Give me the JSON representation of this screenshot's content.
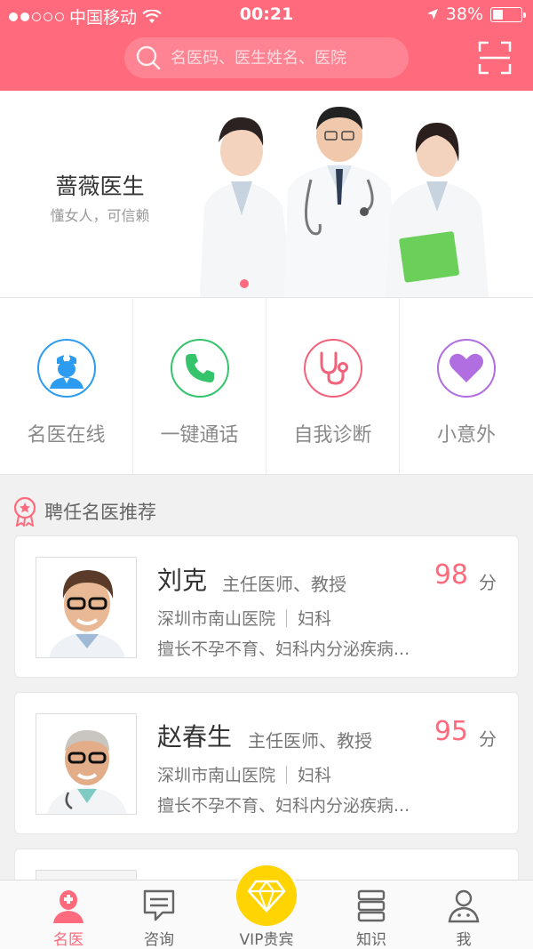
{
  "status_bar": {
    "carrier": "中国移动",
    "time": "00:21",
    "battery_text": "38%",
    "battery_level": 0.38
  },
  "search": {
    "placeholder": "名医码、医生姓名、医院"
  },
  "banner": {
    "title": "蔷薇医生",
    "subtitle": "懂女人，可信赖"
  },
  "quick_actions": [
    {
      "label": "名医在线",
      "icon": "doctor-icon",
      "color": "#2d9cf0"
    },
    {
      "label": "一键通话",
      "icon": "phone-icon",
      "color": "#35c46c"
    },
    {
      "label": "自我诊断",
      "icon": "stethoscope-icon",
      "color": "#f2627a"
    },
    {
      "label": "小意外",
      "icon": "heart-icon",
      "color": "#b06ee0"
    }
  ],
  "section": {
    "title": "聘任名医推荐"
  },
  "doctors": [
    {
      "name": "刘克",
      "title": "主任医师、教授",
      "score": "98",
      "score_unit": "分",
      "hospital": "深圳市南山医院",
      "department": "妇科",
      "description": "擅长不孕不育、妇科内分泌疾病..."
    },
    {
      "name": "赵春生",
      "title": "主任医师、教授",
      "score": "95",
      "score_unit": "分",
      "hospital": "深圳市南山医院",
      "department": "妇科",
      "description": "擅长不孕不育、妇科内分泌疾病..."
    }
  ],
  "tabbar": {
    "items": [
      {
        "label": "名医",
        "icon": "doctor-tab-icon",
        "active": true
      },
      {
        "label": "咨询",
        "icon": "chat-icon",
        "active": false
      },
      {
        "label": "VIP贵宾",
        "icon": "diamond-icon",
        "active": false
      },
      {
        "label": "知识",
        "icon": "books-icon",
        "active": false
      },
      {
        "label": "我",
        "icon": "user-icon",
        "active": false
      }
    ]
  },
  "colors": {
    "brand": "#ff6a7c",
    "vip": "#ffd400"
  }
}
